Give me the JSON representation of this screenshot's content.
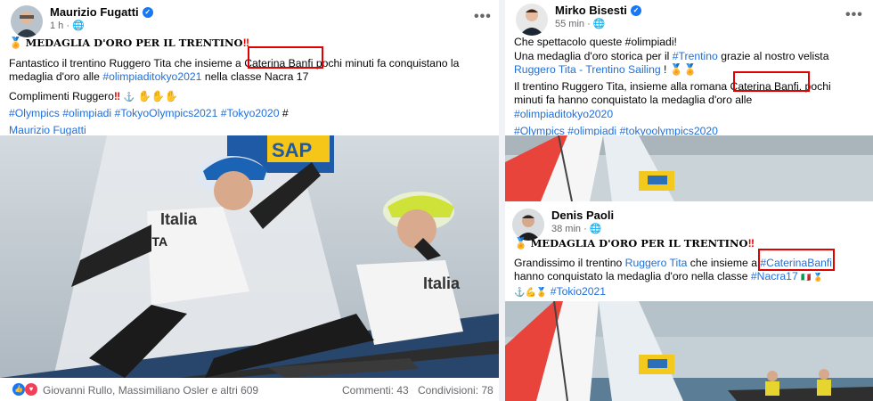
{
  "post1": {
    "author": "Maurizio Fugatti",
    "time": "1 h",
    "title": "MEDAGLIA D'ORO PER IL TRENTINO",
    "line1_a": "Fantastico il trentino Ruggero Tita che insieme a ",
    "line1_b": "Caterina Banfi",
    "line1_c": " pochi minuti fa conquistano la",
    "line2_a": "medaglia d'oro alle ",
    "line2_tag": "#olimpiaditokyo2021",
    "line2_c": " nella classe Nacra 17",
    "line3": "Complimenti Ruggero",
    "hashtags": "#Olympics #olimpiadi #TokyoOlympics2021 #Tokyo2020",
    "hashtags_end": " #",
    "mention": "Maurizio Fugatti",
    "reactions": "Giovanni Rullo, Massimiliano Osler e altri 609",
    "comments": "Commenti: 43",
    "shares": "Condivisioni: 78"
  },
  "post2": {
    "author": "Mirko Bisesti",
    "time": "55 min",
    "line1": "Che spettacolo queste #olimpiadi!",
    "line2_a": "Una medaglia d'oro storica per il ",
    "line2_tag": "#Trentino",
    "line2_c": " grazie al nostro velista",
    "line3_link": "Ruggero Tita - Trentino Sailing",
    "line3_c": " !",
    "line4_a": "Il trentino Ruggero Tita, insieme alla romana ",
    "line4_b": "Caterina Banfi,",
    "line4_c": " pochi",
    "line5": "minuti fa hanno  conquistato la medaglia d'oro alle",
    "line6": "#olimpiaditokyo2020",
    "line7": "#Olympics #olimpiadi #tokyoolympics2020"
  },
  "post3": {
    "author": "Denis Paoli",
    "time": "38 min",
    "title": "MEDAGLIA D'ORO PER IL TRENTINO",
    "line1_a": "Grandissimo il trentino ",
    "line1_link": "Ruggero Tita",
    "line1_b": " che insieme a ",
    "line1_tag": "#CaterinaBanfi",
    "line2_a": "hanno conquistato la medaglia d'oro nella classe ",
    "line2_tag": "#Nacra17",
    "line3_tag": "#Tokio2021"
  },
  "colors": {
    "link": "#216fdb",
    "highlight": "#e00000",
    "verified": "#1877f2"
  }
}
